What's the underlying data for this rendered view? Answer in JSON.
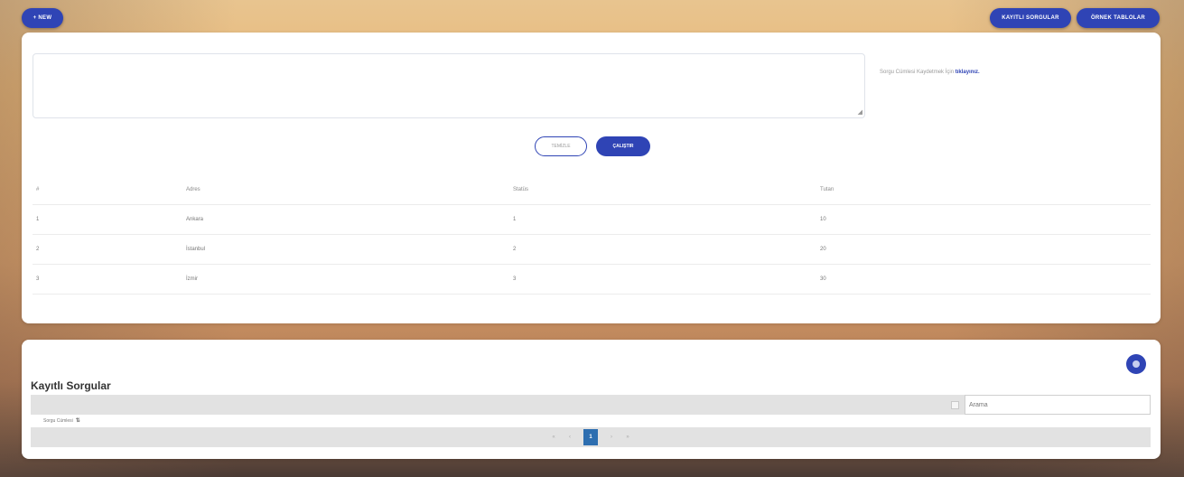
{
  "header": {
    "new_label": "+ NEW",
    "saved_queries_label": "KAYITLI SORGULAR",
    "sample_tables_label": "ÖRNEK TABLOLAR"
  },
  "editor": {
    "query_value": "",
    "hint_text": "Sorgu Cümlesi Kaydetmek İçin",
    "hint_link": "tıklayınız."
  },
  "actions": {
    "clear_label": "TEMİZLE",
    "run_label": "ÇALIŞTIR"
  },
  "result_table": {
    "headers": [
      "#",
      "Adres",
      "Statüs",
      "Tutarı"
    ],
    "rows": [
      [
        "1",
        "Ankara",
        "1",
        "10"
      ],
      [
        "2",
        "İstanbul",
        "2",
        "20"
      ],
      [
        "3",
        "İzmir",
        "3",
        "30"
      ]
    ]
  },
  "saved_queries": {
    "title": "Kayıtlı Sorgular",
    "search_placeholder": "Arama",
    "column_header": "Sorgu Cümlesi",
    "sort_glyph": "⇅",
    "pager": {
      "first": "«",
      "prev": "‹",
      "current": "1",
      "next": "›",
      "last": "»"
    }
  }
}
